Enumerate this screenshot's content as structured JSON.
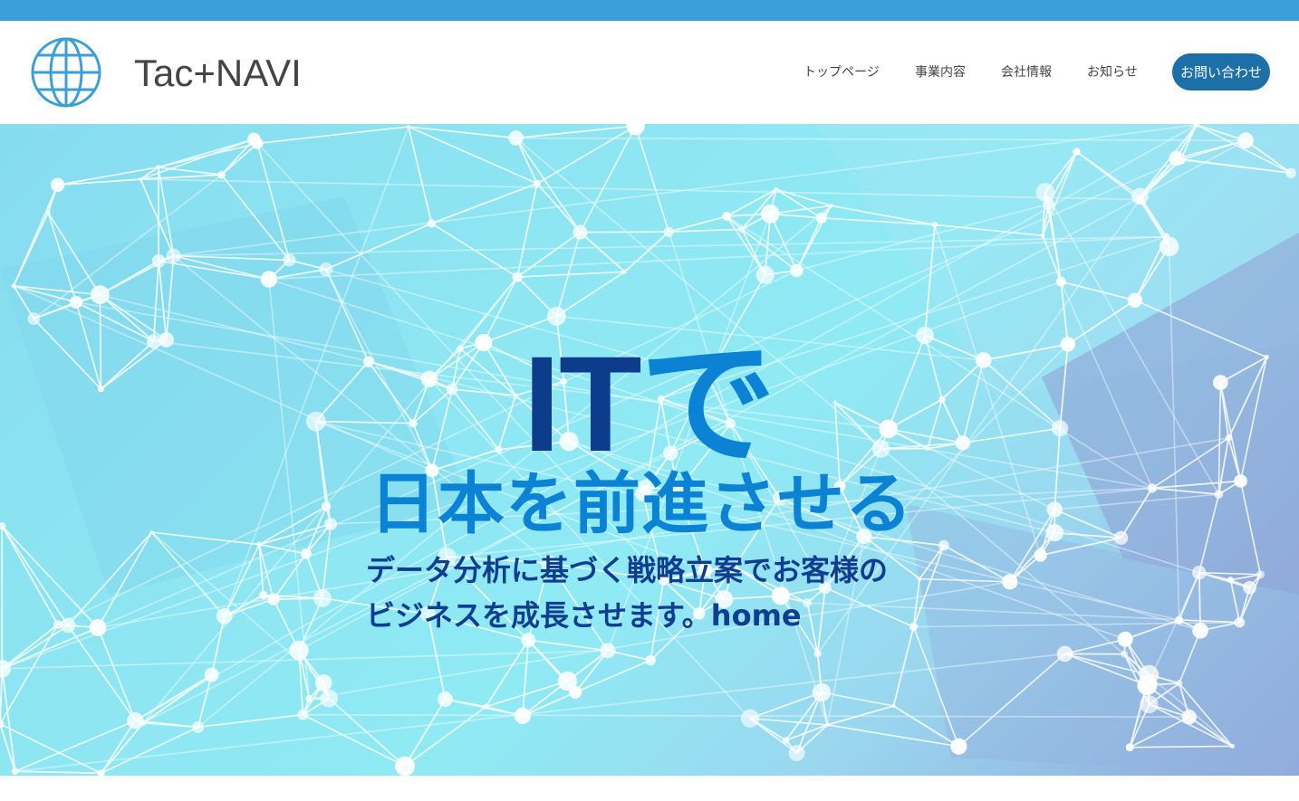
{
  "header": {
    "logo_icon": "globe-icon",
    "logo_text": "Tac+NAVI"
  },
  "nav": {
    "items": [
      {
        "label": "トップページ"
      },
      {
        "label": "事業内容"
      },
      {
        "label": "会社情報"
      },
      {
        "label": "お知らせ"
      }
    ],
    "contact_label": "お問い合わせ"
  },
  "hero": {
    "title_it": "IT",
    "title_de": "で",
    "title_line2": "日本を前進させる",
    "subtitle_line1": "データ分析に基づく戦略立案でお客様の",
    "subtitle_line2": "ビジネスを成長させます。home"
  },
  "colors": {
    "top_bar": "#3a9fd9",
    "button": "#1d6fa7",
    "title_dark": "#0d3c8c",
    "title_accent": "#0b82d4"
  }
}
